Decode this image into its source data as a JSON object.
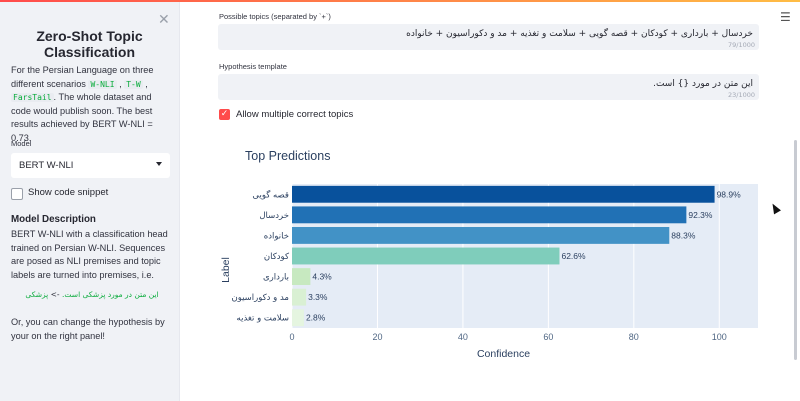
{
  "sidebar": {
    "close_symbol": "✕",
    "title": "Zero-Shot Topic Classification",
    "intro_before": "For the Persian Language on three different scenarios ",
    "scenario_1": "W-NLI",
    "scenario_2": "T-W",
    "scenario_3": "FarsTail",
    "intro_after": ". The whole dataset and code would publish soon. The best results achieved by BERT W-NLI = 0.73.",
    "model_label": "Model",
    "model_value": "BERT W-NLI",
    "show_code_label": "Show code snippet",
    "desc_heading": "Model Description",
    "desc_text": "BERT W-NLI with a classification head trained on Persian W-NLI. Sequences are posed as NLI premises and topic labels are turned into premises, i.e.",
    "example_label": "پزشکی",
    "example_arrow": "->",
    "example_hypothesis": "این متن در مورد پزشکی است.",
    "outro": "Or, you can change the hypothesis by your on the right panel!"
  },
  "main": {
    "topics_label": "Possible topics (separated by `+`)",
    "topics_value": "خردسال + بارداری + کودکان + قصه گویی + سلامت و تغذیه + مد و دکوراسیون + خانواده",
    "topics_count": "79/1000",
    "hypothesis_label": "Hypothesis template",
    "hypothesis_value": "این متن در مورد {} است.",
    "hypothesis_count": "23/1000",
    "multi_label": "Allow multiple correct topics"
  },
  "chart_data": {
    "type": "bar",
    "orientation": "horizontal",
    "title": "Top Predictions",
    "xlabel": "Confidence",
    "ylabel": "Label",
    "xlim": [
      0,
      110
    ],
    "xticks": [
      0,
      20,
      40,
      60,
      80,
      100
    ],
    "categories": [
      "قصه گویی",
      "خردسال",
      "خانواده",
      "کودکان",
      "بارداری",
      "مد و دکوراسیون",
      "سلامت و تغذیه"
    ],
    "values": [
      98.9,
      92.3,
      88.3,
      62.6,
      4.3,
      3.3,
      2.8
    ],
    "value_labels": [
      "98.9%",
      "92.3%",
      "88.3%",
      "62.6%",
      "4.3%",
      "3.3%",
      "2.8%"
    ],
    "colors": [
      "#08519c",
      "#2171b5",
      "#4292c6",
      "#7fcdbb",
      "#c7e9c0",
      "#d9f0d3",
      "#e5f5e0"
    ],
    "plot_bg": "#e5ecf6",
    "grid": true
  }
}
